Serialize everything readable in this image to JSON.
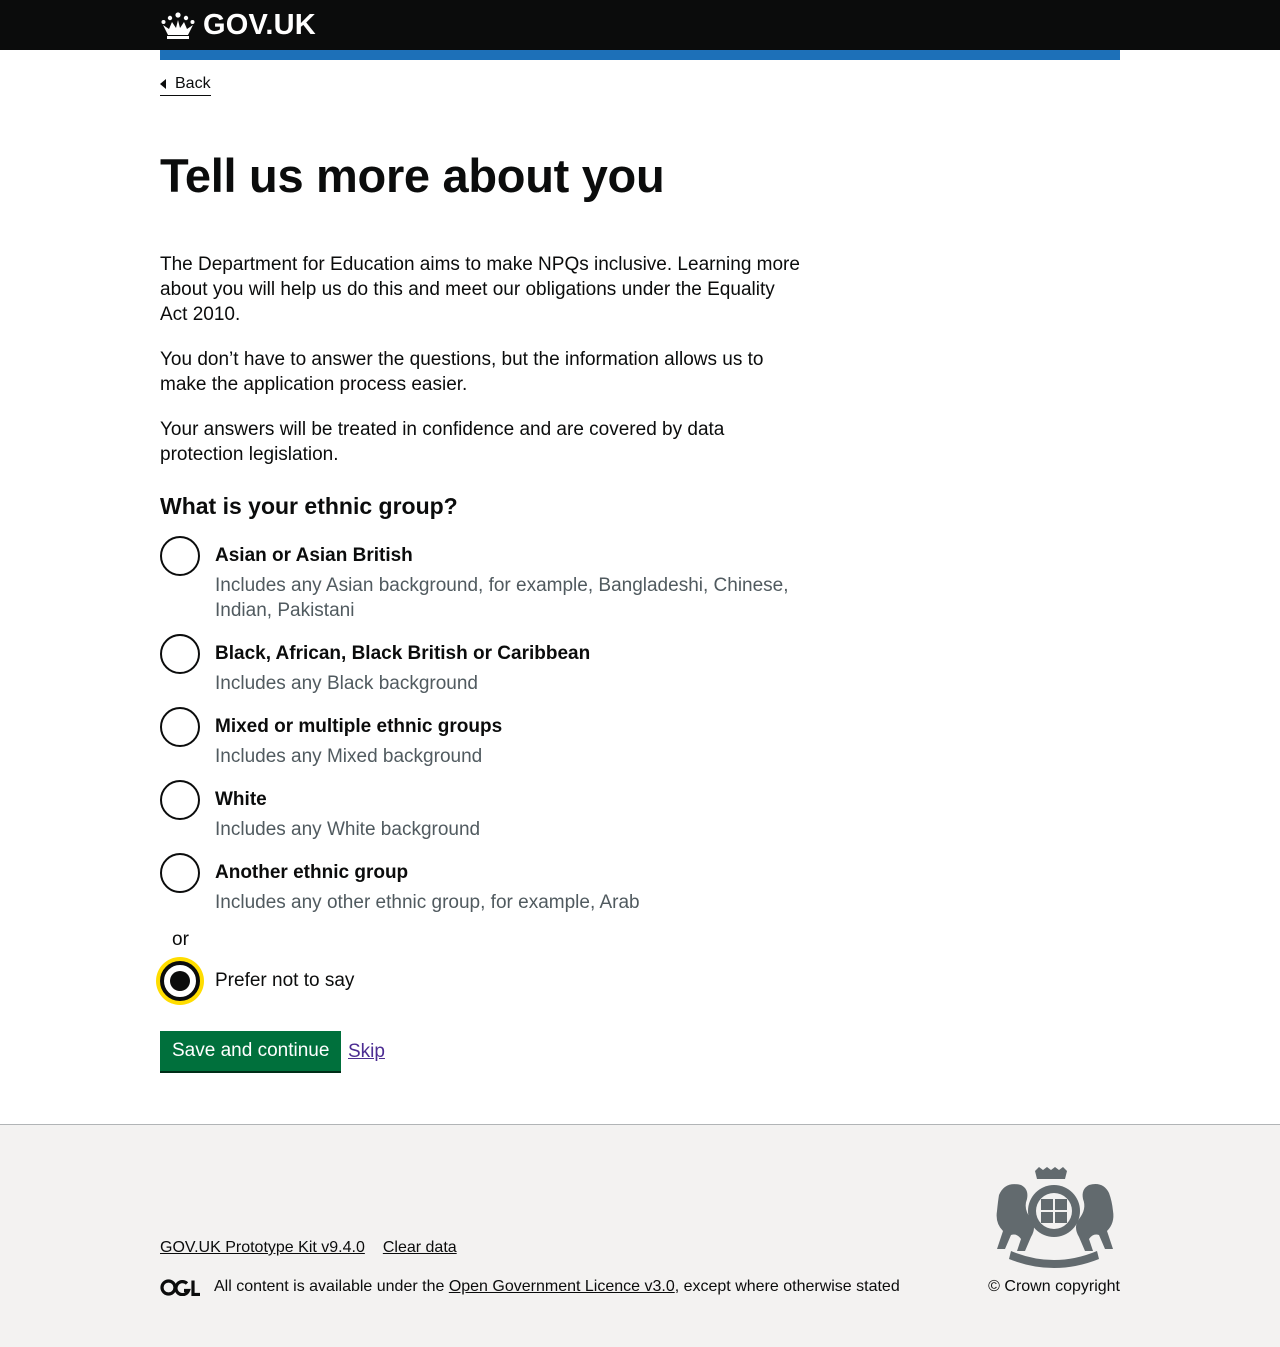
{
  "header": {
    "logo_text": "GOV.UK",
    "logo_icon": "crown-icon",
    "accent_color": "#1d70b8"
  },
  "back_link": {
    "label": "Back",
    "icon": "chevron-left-icon"
  },
  "page": {
    "title": "Tell us more about you",
    "paragraphs": [
      "The Department for Education aims to make NPQs inclusive. Learning more about you will help us do this and meet our obligations under the Equality Act 2010.",
      "You don’t have to answer the questions, but the information allows us to make the application process easier.",
      "Your answers will be treated in confidence and are covered by data protection legislation."
    ]
  },
  "question": {
    "legend": "What is your ethnic group?",
    "options": [
      {
        "label": "Asian or Asian British",
        "hint": "Includes any Asian background, for example, Bangladeshi, Chinese, Indian, Pakistani",
        "checked": false
      },
      {
        "label": "Black, African, Black British or Caribbean",
        "hint": "Includes any Black background",
        "checked": false
      },
      {
        "label": "Mixed or multiple ethnic groups",
        "hint": "Includes any Mixed background",
        "checked": false
      },
      {
        "label": "White",
        "hint": "Includes any White background",
        "checked": false
      },
      {
        "label": "Another ethnic group",
        "hint": "Includes any other ethnic group, for example, Arab",
        "checked": false
      }
    ],
    "divider": "or",
    "exclusive_option": {
      "label": "Prefer not to say",
      "checked": true
    },
    "focus_color": "#ffdd00"
  },
  "actions": {
    "primary_label": "Save and continue",
    "primary_color": "#00703c",
    "secondary_label": "Skip"
  },
  "footer": {
    "links": [
      "GOV.UK Prototype Kit v9.4.0",
      "Clear data"
    ],
    "licence_prefix": "All content is available under the ",
    "licence_link": "Open Government Licence v3.0",
    "licence_suffix": ", except where otherwise stated",
    "ogl_icon": "ogl-logo-icon",
    "crest_icon": "royal-coat-of-arms-icon",
    "copyright": "© Crown copyright"
  }
}
